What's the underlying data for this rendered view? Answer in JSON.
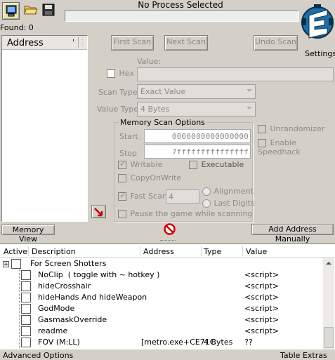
{
  "toolbar": {
    "process_title": "No Process Selected",
    "found_label": "Found: 0",
    "settings_label": "Settings"
  },
  "results_list": {
    "address_header": "Address",
    "column_marker": "'"
  },
  "scan": {
    "first_scan": "First Scan",
    "next_scan": "Next Scan",
    "undo_scan": "Undo Scan",
    "value_label": "Value:",
    "hex_label": "Hex",
    "scan_type_label": "Scan Type",
    "scan_type_value": "Exact Value",
    "value_type_label": "Value Type",
    "value_type_value": "4 Bytes"
  },
  "memory_options": {
    "title": "Memory Scan Options",
    "start_label": "Start",
    "start_value": "0000000000000000",
    "stop_label": "Stop",
    "stop_value": "7fffffffffffffff",
    "writable": "Writable",
    "executable": "Executable",
    "copyonwrite": "CopyOnWrite",
    "fast_scan": "Fast Scan",
    "fast_scan_value": "4",
    "alignment": "Alignment",
    "last_digits": "Last Digits",
    "pause_game": "Pause the game while scanning"
  },
  "side_options": {
    "unrandomizer": "Unrandomizer",
    "enable_speedhack": "Enable Speedhack"
  },
  "bottom_bar": {
    "memory_view": "Memory View",
    "add_address": "Add Address Manually"
  },
  "table": {
    "headers": {
      "active": "Active",
      "description": "Description",
      "address": "Address",
      "type": "Type",
      "value": "Value"
    },
    "group": "For Screen Shotters",
    "rows": [
      {
        "description": "NoClip  ( toggle with ~ hotkey )",
        "address": "",
        "type": "",
        "value": "<script>"
      },
      {
        "description": "hideCrosshair",
        "address": "",
        "type": "",
        "value": "<script>"
      },
      {
        "description": "hideHands And hideWeapon",
        "address": "",
        "type": "",
        "value": "<script>"
      },
      {
        "description": "GodMode",
        "address": "",
        "type": "",
        "value": "<script>"
      },
      {
        "description": "GasmaskOverride",
        "address": "",
        "type": "",
        "value": "<script>"
      },
      {
        "description": "readme",
        "address": "",
        "type": "",
        "value": "<script>"
      },
      {
        "description": "FOV (M:LL)",
        "address": "[metro.exe+CE71C",
        "type": "4 Bytes",
        "value": "??"
      }
    ]
  },
  "status": {
    "advanced_options": "Advanced Options",
    "table_extras": "Table Extras"
  }
}
